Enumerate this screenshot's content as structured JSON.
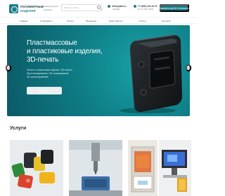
{
  "header": {
    "logo_line1": "ПОЛИМЕРНЫЕ",
    "logo_line2": "ИЗДЕЛИЯ",
    "info_line1": "Производственная",
    "info_line2": "компания",
    "search_placeholder": "Поиск по сайту",
    "email": "info@plast.ru",
    "address": "г. Москва",
    "phone": "+7 (495) 134-15-75",
    "hours": "Пн–Пт 9:00–18:00",
    "cta_label": "Заказать расчёт стоимости"
  },
  "nav": {
    "items": [
      {
        "label": "Главная",
        "dropdown": false
      },
      {
        "label": "О компании",
        "dropdown": true
      },
      {
        "label": "Услуги",
        "dropdown": true
      },
      {
        "label": "Продукция",
        "dropdown": true
      },
      {
        "label": "Наши работы",
        "dropdown": true
      },
      {
        "label": "Статьи",
        "dropdown": false
      },
      {
        "label": "Контакты",
        "dropdown": false
      }
    ]
  },
  "hero": {
    "title_lines": [
      "Пластмассовые",
      "и пластиковые изделия,",
      "3D-печать"
    ],
    "subtitle_lines": [
      "Литье в силиконовые формы / 3D печать",
      "Прототипирование / 3D сканирование",
      "3D проектирование"
    ],
    "button_label": "Подробнее",
    "prev_label": "‹",
    "next_label": "›",
    "slide_count": 3,
    "active_slide": 0
  },
  "services": {
    "title": "Услуги",
    "cards": [
      {
        "name": "plastic-parts"
      },
      {
        "name": "cnc-machining"
      },
      {
        "name": "3d-printing"
      },
      {
        "name": "3d-scanning"
      }
    ]
  },
  "colors": {
    "brand": "#1e7d8a",
    "hero_dark": "#0b5a66",
    "hero_light": "#17a3a8"
  }
}
